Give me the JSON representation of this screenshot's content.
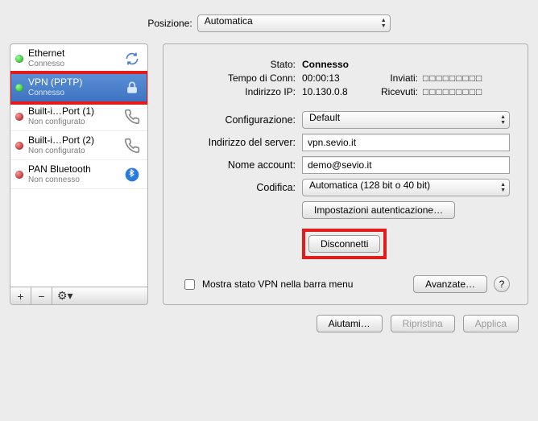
{
  "topbar": {
    "location_label": "Posizione:",
    "location_value": "Automatica"
  },
  "connections": [
    {
      "name": "Ethernet",
      "status": "Connesso",
      "dot": "green",
      "icon": "sync"
    },
    {
      "name": "VPN (PPTP)",
      "status": "Connesso",
      "dot": "green",
      "icon": "lock",
      "selected": true,
      "highlighted": true
    },
    {
      "name": "Built-i…Port (1)",
      "status": "Non configurato",
      "dot": "red",
      "icon": "phone"
    },
    {
      "name": "Built-i…Port (2)",
      "status": "Non configurato",
      "dot": "red",
      "icon": "phone"
    },
    {
      "name": "PAN Bluetooth",
      "status": "Non connesso",
      "dot": "red",
      "icon": "bluetooth"
    }
  ],
  "list_footer": {
    "add": "+",
    "remove": "−",
    "gear": "⚙︎▾"
  },
  "detail": {
    "state_label": "Stato:",
    "state_value": "Connesso",
    "conntime_label": "Tempo di Conn:",
    "conntime_value": "00:00:13",
    "sent_label": "Inviati:",
    "sent_value": "□□□□□□□□□",
    "ip_label": "Indirizzo IP:",
    "ip_value": "10.130.0.8",
    "recv_label": "Ricevuti:",
    "recv_value": "□□□□□□□□□",
    "config_label": "Configurazione:",
    "config_value": "Default",
    "server_label": "Indirizzo del server:",
    "server_value": "vpn.sevio.it",
    "account_label": "Nome account:",
    "account_value": "demo@sevio.it",
    "encoding_label": "Codifica:",
    "encoding_value": "Automatica (128 bit o 40 bit)",
    "auth_btn": "Impostazioni autenticazione…",
    "disconnect_btn": "Disconnetti",
    "show_vpn_label": "Mostra stato VPN nella barra menu",
    "advanced_btn": "Avanzate…",
    "help": "?"
  },
  "bottom": {
    "assist": "Aiutami…",
    "revert": "Ripristina",
    "apply": "Applica"
  }
}
